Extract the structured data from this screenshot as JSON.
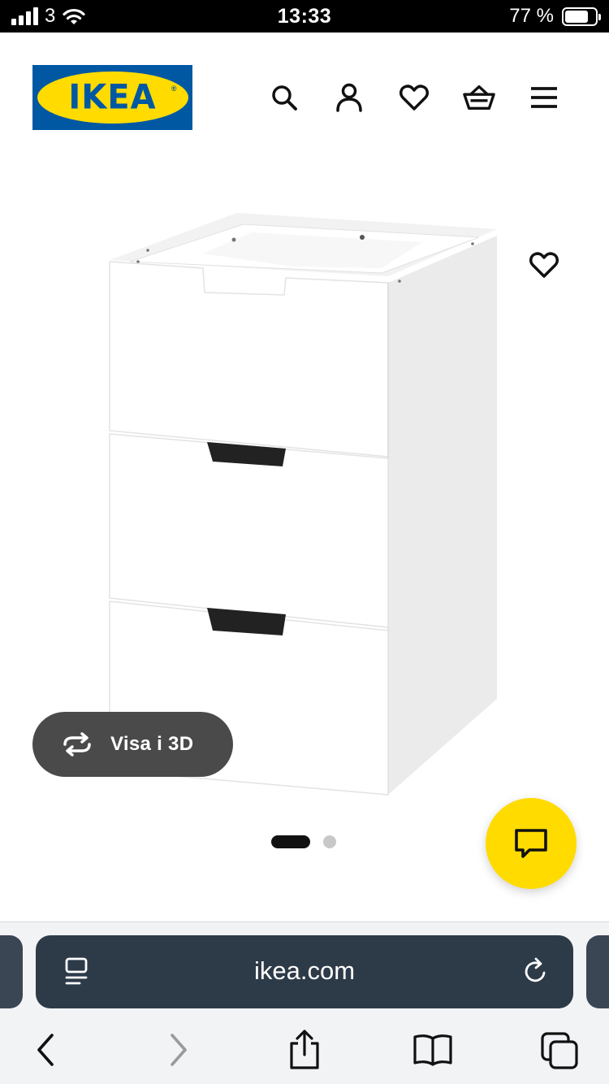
{
  "status_bar": {
    "carrier": "3",
    "time": "13:33",
    "battery": "77 %",
    "battery_level": 0.77
  },
  "header": {
    "logo_text": "IKEA",
    "icons": [
      "search-icon",
      "user-icon",
      "heart-icon",
      "basket-icon",
      "menu-icon"
    ]
  },
  "product": {
    "view_3d_label": "Visa i 3D",
    "image_count": 2,
    "active_image": 1
  },
  "browser": {
    "url": "ikea.com"
  },
  "colors": {
    "ikea_blue": "#0058a3",
    "ikea_yellow": "#ffdb00",
    "url_bar": "#2d3a48",
    "view3d_pill": "#4a4a4a"
  }
}
